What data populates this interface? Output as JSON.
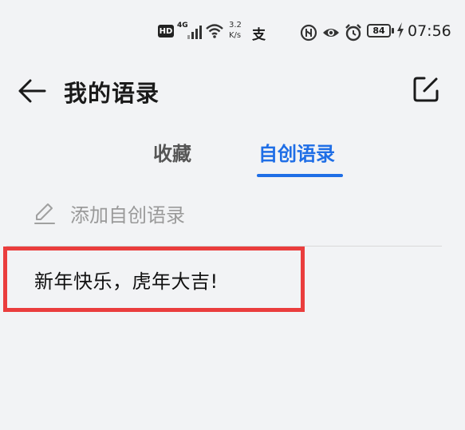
{
  "status_bar": {
    "hd": "HD",
    "network": "4G",
    "speed_value": "3.2",
    "speed_unit": "K/s",
    "app_glyph": "支",
    "battery": "84",
    "time": "07:56",
    "icons": [
      "hd-icon",
      "signal-icon",
      "wifi-icon",
      "alipay-icon",
      "nfc-icon",
      "eye-icon",
      "alarm-icon",
      "battery-icon",
      "charging-icon"
    ]
  },
  "header": {
    "title": "我的语录",
    "back_icon": "arrow-left-icon",
    "edit_icon": "edit-square-icon"
  },
  "tabs": [
    {
      "label": "收藏",
      "active": false
    },
    {
      "label": "自创语录",
      "active": true
    }
  ],
  "add_row": {
    "label": "添加自创语录",
    "icon": "pencil-icon"
  },
  "quotes": [
    {
      "text": "新年快乐，虎年大吉!"
    }
  ],
  "colors": {
    "accent": "#1f6ee6",
    "highlight_border": "#ea3d3d",
    "background": "#f2f3f5"
  }
}
